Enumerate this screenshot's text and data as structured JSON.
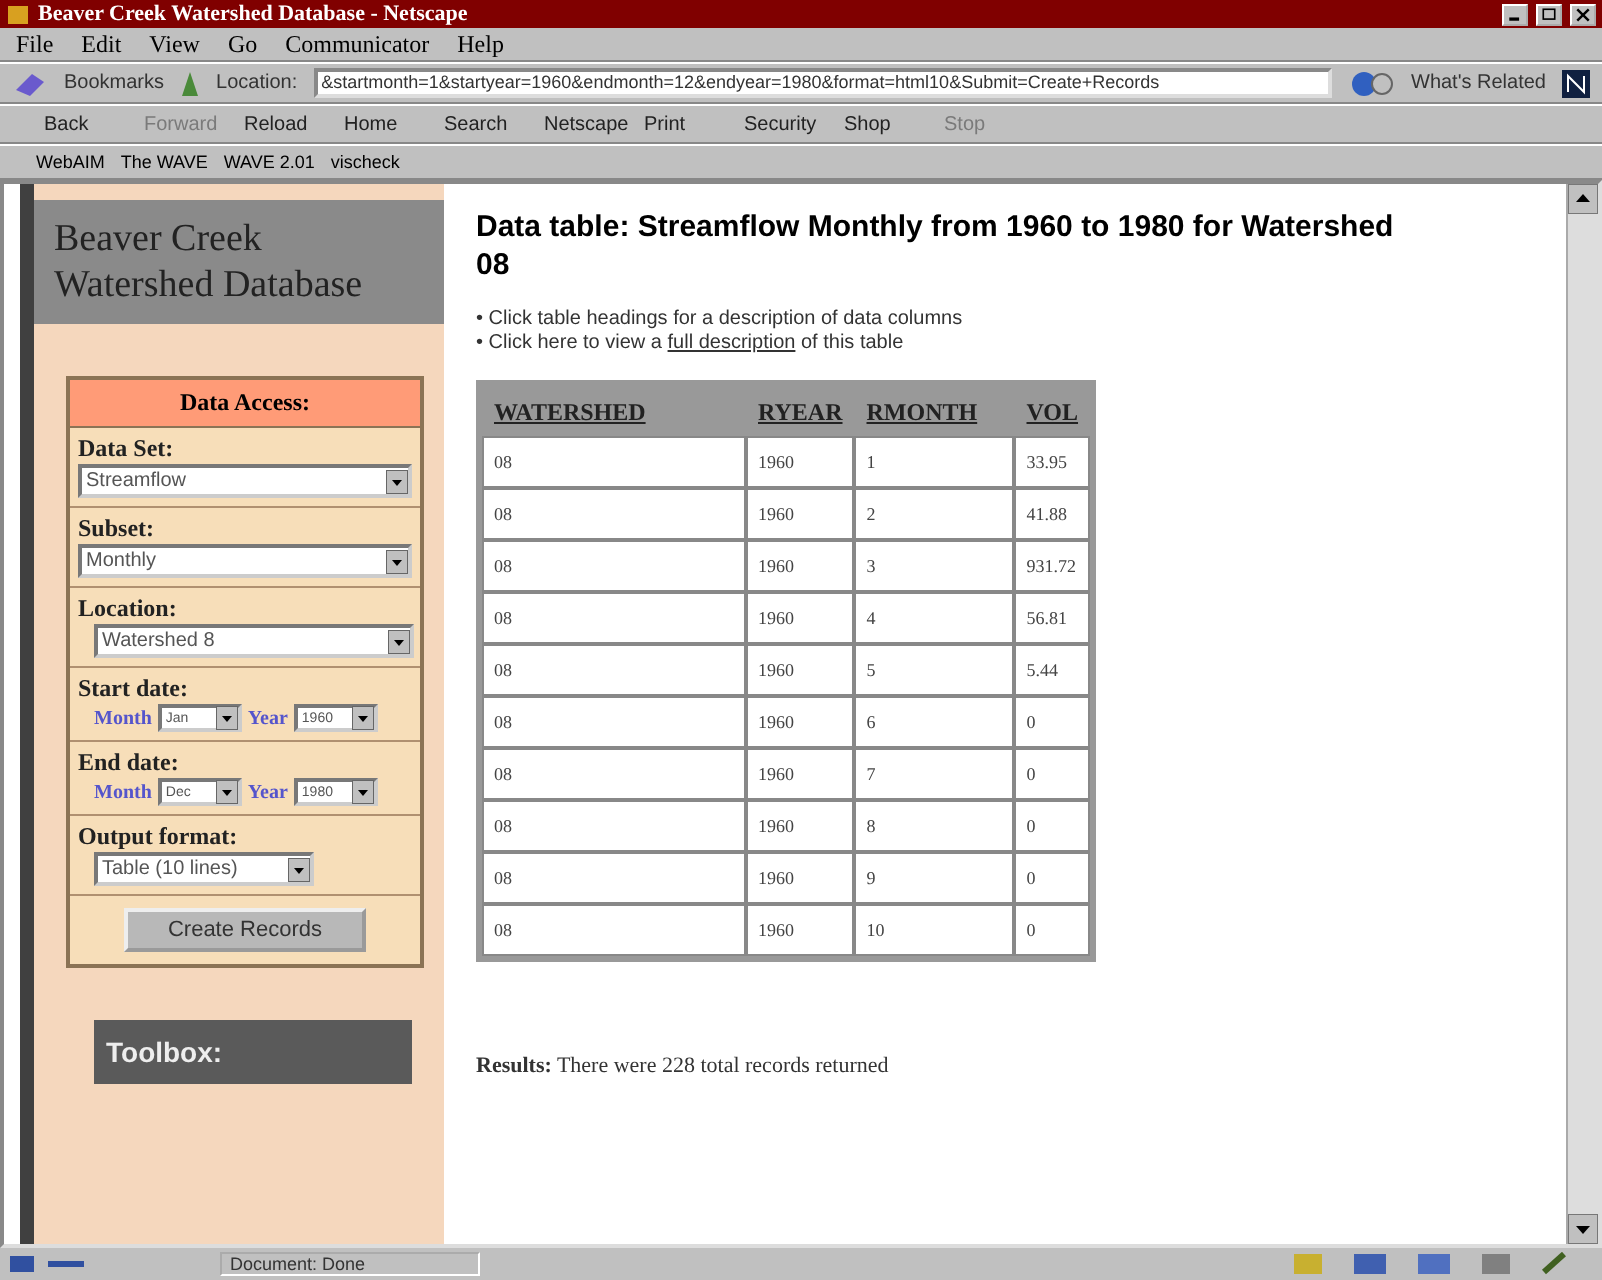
{
  "window": {
    "title": "Beaver Creek Watershed Database - Netscape"
  },
  "menu": [
    "File",
    "Edit",
    "View",
    "Go",
    "Communicator",
    "Help"
  ],
  "location_bar": {
    "bookmarks": "Bookmarks",
    "label": "Location:",
    "url": "&startmonth=1&startyear=1960&endmonth=12&endyear=1980&format=html10&Submit=Create+Records",
    "related": "What's Related"
  },
  "nav_buttons": [
    {
      "label": "Back",
      "disabled": false
    },
    {
      "label": "Forward",
      "disabled": true
    },
    {
      "label": "Reload",
      "disabled": false
    },
    {
      "label": "Home",
      "disabled": false
    },
    {
      "label": "Search",
      "disabled": false
    },
    {
      "label": "Netscape",
      "disabled": false
    },
    {
      "label": "Print",
      "disabled": false
    },
    {
      "label": "Security",
      "disabled": false
    },
    {
      "label": "Shop",
      "disabled": false
    },
    {
      "label": "Stop",
      "disabled": true
    }
  ],
  "personal_bar": [
    "WebAIM",
    "The WAVE",
    "WAVE 2.01",
    "vischeck"
  ],
  "sidebar": {
    "site_title": "Beaver Creek Watershed Database",
    "panel_title": "Data Access:",
    "fields": [
      {
        "kind": "select",
        "label": "Data Set:",
        "value": "Streamflow"
      },
      {
        "kind": "select",
        "label": "Subset:",
        "value": "Monthly"
      },
      {
        "kind": "select",
        "label": "Location:",
        "value": "Watershed 8"
      },
      {
        "kind": "date",
        "label": "Start date:",
        "month_label": "Month",
        "month": "Jan",
        "year_label": "Year",
        "year": "1960"
      },
      {
        "kind": "date",
        "label": "End date:",
        "month_label": "Month",
        "month": "Dec",
        "year_label": "Year",
        "year": "1980"
      },
      {
        "kind": "select",
        "label": "Output format:",
        "value": "Table (10 lines)"
      }
    ],
    "submit": "Create Records",
    "toolbox": "Toolbox:"
  },
  "content": {
    "heading": "Data table: Streamflow Monthly from 1960 to 1980 for Watershed 08",
    "notes": [
      {
        "bullet": "•",
        "before": "Click table headings for a description of data columns"
      },
      {
        "bullet": "•",
        "before": "Click here to view a",
        "link": "full description",
        "after": "of this table"
      }
    ],
    "table": {
      "columns": [
        "WATERSHED",
        "RYEAR",
        "RMONTH",
        "VOL"
      ],
      "rows": [
        [
          "08",
          "1960",
          "1",
          "33.95"
        ],
        [
          "08",
          "1960",
          "2",
          "41.88"
        ],
        [
          "08",
          "1960",
          "3",
          "931.72"
        ],
        [
          "08",
          "1960",
          "4",
          "56.81"
        ],
        [
          "08",
          "1960",
          "5",
          "5.44"
        ],
        [
          "08",
          "1960",
          "6",
          "0"
        ],
        [
          "08",
          "1960",
          "7",
          "0"
        ],
        [
          "08",
          "1960",
          "8",
          "0"
        ],
        [
          "08",
          "1960",
          "9",
          "0"
        ],
        [
          "08",
          "1960",
          "10",
          "0"
        ]
      ]
    },
    "results": "**Results:** There were 228 total records returned"
  },
  "status_bar": {
    "text": "Document: Done"
  }
}
